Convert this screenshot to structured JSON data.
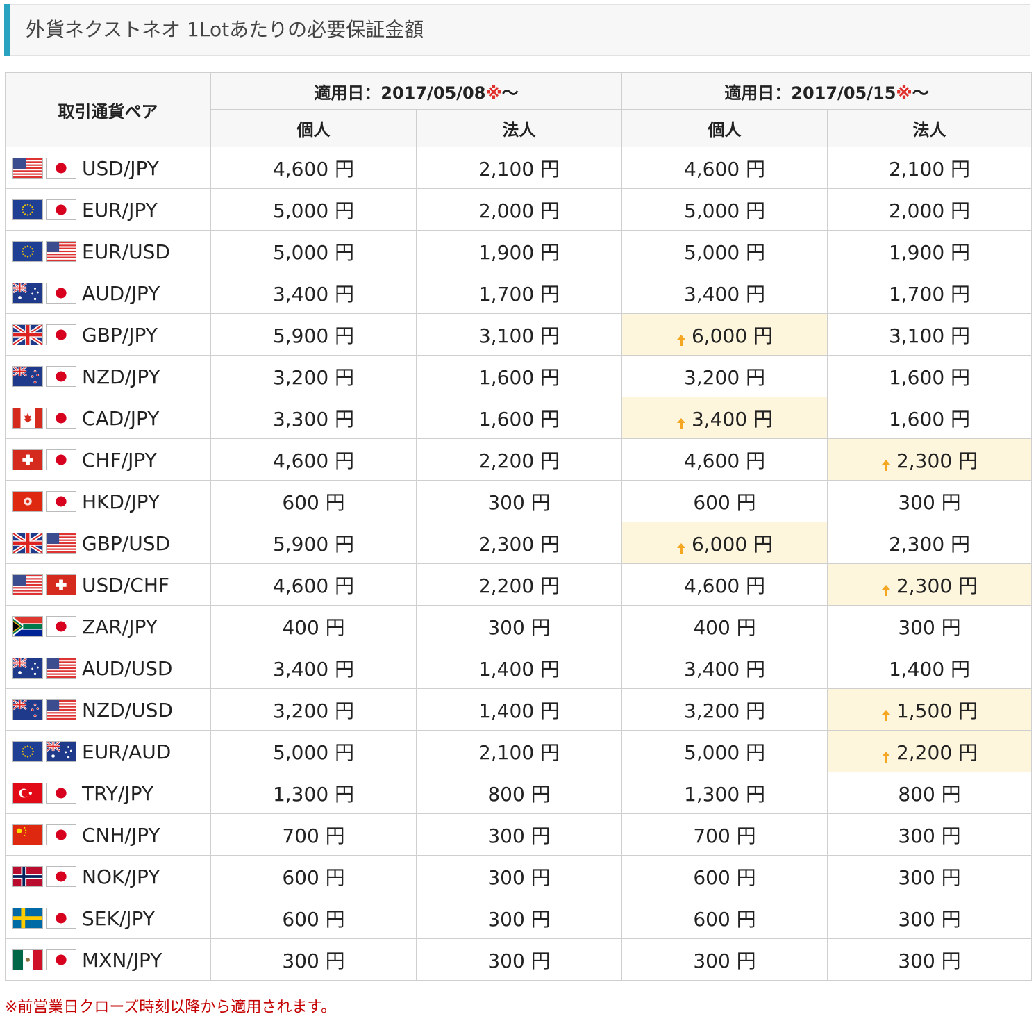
{
  "title": "外貨ネクストネオ 1Lotあたりの必要保証金額",
  "table": {
    "pair_header": "取引通貨ペア",
    "periods": [
      {
        "label": "適用日：2017/05/08",
        "mark": "※",
        "tilde": "〜"
      },
      {
        "label": "適用日：2017/05/15",
        "mark": "※",
        "tilde": "〜"
      }
    ],
    "sub_headers": [
      "個人",
      "法人",
      "個人",
      "法人"
    ],
    "rows": [
      {
        "flags": [
          "us",
          "jp"
        ],
        "pair": "USD/JPY",
        "values": [
          "4,600 円",
          "2,100 円",
          "4,600 円",
          "2,100 円"
        ],
        "raised": [
          false,
          false,
          false,
          false
        ]
      },
      {
        "flags": [
          "eu",
          "jp"
        ],
        "pair": "EUR/JPY",
        "values": [
          "5,000 円",
          "2,000 円",
          "5,000 円",
          "2,000 円"
        ],
        "raised": [
          false,
          false,
          false,
          false
        ]
      },
      {
        "flags": [
          "eu",
          "us"
        ],
        "pair": "EUR/USD",
        "values": [
          "5,000 円",
          "1,900 円",
          "5,000 円",
          "1,900 円"
        ],
        "raised": [
          false,
          false,
          false,
          false
        ]
      },
      {
        "flags": [
          "au",
          "jp"
        ],
        "pair": "AUD/JPY",
        "values": [
          "3,400 円",
          "1,700 円",
          "3,400 円",
          "1,700 円"
        ],
        "raised": [
          false,
          false,
          false,
          false
        ]
      },
      {
        "flags": [
          "gb",
          "jp"
        ],
        "pair": "GBP/JPY",
        "values": [
          "5,900 円",
          "3,100 円",
          "6,000 円",
          "3,100 円"
        ],
        "raised": [
          false,
          false,
          true,
          false
        ]
      },
      {
        "flags": [
          "nz",
          "jp"
        ],
        "pair": "NZD/JPY",
        "values": [
          "3,200 円",
          "1,600 円",
          "3,200 円",
          "1,600 円"
        ],
        "raised": [
          false,
          false,
          false,
          false
        ]
      },
      {
        "flags": [
          "ca",
          "jp"
        ],
        "pair": "CAD/JPY",
        "values": [
          "3,300 円",
          "1,600 円",
          "3,400 円",
          "1,600 円"
        ],
        "raised": [
          false,
          false,
          true,
          false
        ]
      },
      {
        "flags": [
          "ch",
          "jp"
        ],
        "pair": "CHF/JPY",
        "values": [
          "4,600 円",
          "2,200 円",
          "4,600 円",
          "2,300 円"
        ],
        "raised": [
          false,
          false,
          false,
          true
        ]
      },
      {
        "flags": [
          "hk",
          "jp"
        ],
        "pair": "HKD/JPY",
        "values": [
          "600 円",
          "300 円",
          "600 円",
          "300 円"
        ],
        "raised": [
          false,
          false,
          false,
          false
        ]
      },
      {
        "flags": [
          "gb",
          "us"
        ],
        "pair": "GBP/USD",
        "values": [
          "5,900 円",
          "2,300 円",
          "6,000 円",
          "2,300 円"
        ],
        "raised": [
          false,
          false,
          true,
          false
        ]
      },
      {
        "flags": [
          "us",
          "ch"
        ],
        "pair": "USD/CHF",
        "values": [
          "4,600 円",
          "2,200 円",
          "4,600 円",
          "2,300 円"
        ],
        "raised": [
          false,
          false,
          false,
          true
        ]
      },
      {
        "flags": [
          "za",
          "jp"
        ],
        "pair": "ZAR/JPY",
        "values": [
          "400 円",
          "300 円",
          "400 円",
          "300 円"
        ],
        "raised": [
          false,
          false,
          false,
          false
        ]
      },
      {
        "flags": [
          "au",
          "us"
        ],
        "pair": "AUD/USD",
        "values": [
          "3,400 円",
          "1,400 円",
          "3,400 円",
          "1,400 円"
        ],
        "raised": [
          false,
          false,
          false,
          false
        ]
      },
      {
        "flags": [
          "nz",
          "us"
        ],
        "pair": "NZD/USD",
        "values": [
          "3,200 円",
          "1,400 円",
          "3,200 円",
          "1,500 円"
        ],
        "raised": [
          false,
          false,
          false,
          true
        ]
      },
      {
        "flags": [
          "eu",
          "au"
        ],
        "pair": "EUR/AUD",
        "values": [
          "5,000 円",
          "2,100 円",
          "5,000 円",
          "2,200 円"
        ],
        "raised": [
          false,
          false,
          false,
          true
        ]
      },
      {
        "flags": [
          "tr",
          "jp"
        ],
        "pair": "TRY/JPY",
        "values": [
          "1,300 円",
          "800 円",
          "1,300 円",
          "800 円"
        ],
        "raised": [
          false,
          false,
          false,
          false
        ]
      },
      {
        "flags": [
          "cn",
          "jp"
        ],
        "pair": "CNH/JPY",
        "values": [
          "700 円",
          "300 円",
          "700 円",
          "300 円"
        ],
        "raised": [
          false,
          false,
          false,
          false
        ]
      },
      {
        "flags": [
          "no",
          "jp"
        ],
        "pair": "NOK/JPY",
        "values": [
          "600 円",
          "300 円",
          "600 円",
          "300 円"
        ],
        "raised": [
          false,
          false,
          false,
          false
        ]
      },
      {
        "flags": [
          "se",
          "jp"
        ],
        "pair": "SEK/JPY",
        "values": [
          "600 円",
          "300 円",
          "600 円",
          "300 円"
        ],
        "raised": [
          false,
          false,
          false,
          false
        ]
      },
      {
        "flags": [
          "mx",
          "jp"
        ],
        "pair": "MXN/JPY",
        "values": [
          "300 円",
          "300 円",
          "300 円",
          "300 円"
        ],
        "raised": [
          false,
          false,
          false,
          false
        ]
      }
    ]
  },
  "footnote": "※前営業日クローズ時刻以降から適用されます。",
  "colors": {
    "accent_bar": "#2aa3c1",
    "raised_cell_bg": "#fdf5dc",
    "raised_arrow": "#f5a623",
    "mark_red": "#e0302b",
    "footnote_red": "#c40000"
  }
}
